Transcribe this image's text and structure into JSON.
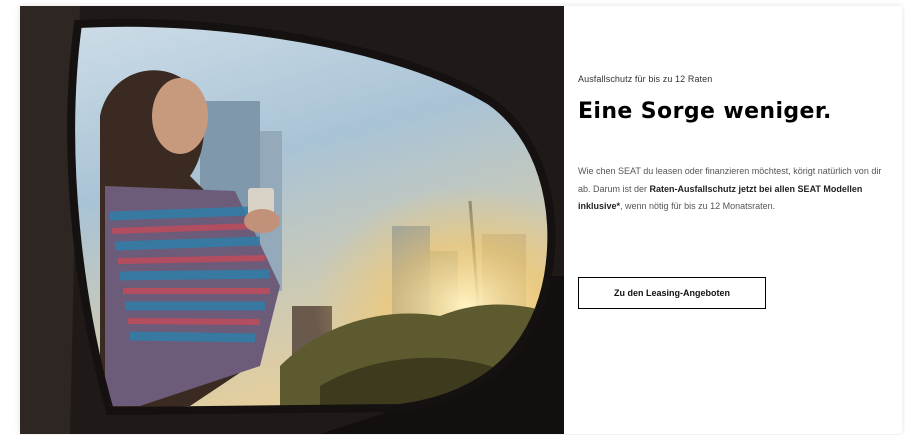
{
  "hero": {
    "image_label": "woman-with-coffee-in-car-side-mirror"
  },
  "teaser": {
    "eyebrow": "Ausfallschutz für bis zu 12 Raten",
    "headline": "Eine Sorge weniger.",
    "body_part1": "Wie chen SEAT du leasen oder finanzieren möchtest, körigt natürlich von dir ab. Darum ist der ",
    "body_bold": "Raten-Ausfallschutz jetzt bei allen SEAT Modellen inklusive*",
    "body_part2": ", wenn nötig für bis zu 12 Monatsraten.",
    "cta_label": "Zu den Leasing-Angeboten"
  },
  "colors": {
    "accent": "#000000",
    "panel_background": "#ffffff",
    "body_text": "#555555"
  }
}
